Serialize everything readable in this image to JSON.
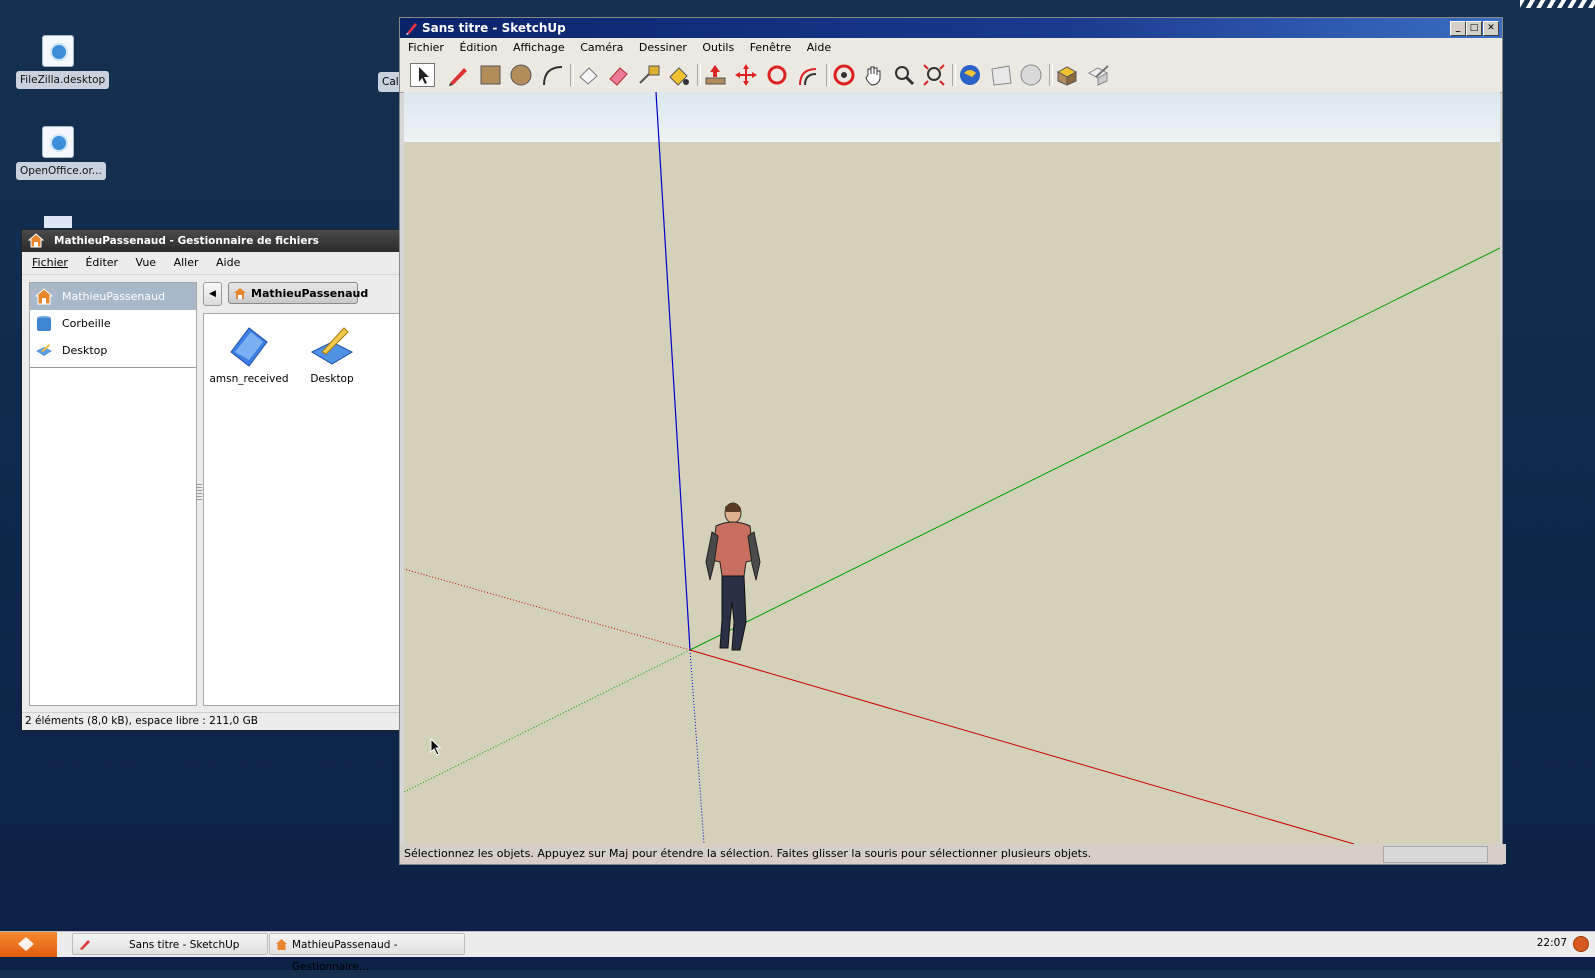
{
  "desktop": {
    "icons": [
      {
        "label": "FileZilla.desktop"
      },
      {
        "label": "OpenOffice.or..."
      }
    ],
    "partial_label": "Cal"
  },
  "file_manager": {
    "title": "MathieuPassenaud - Gestionnaire de fichiers",
    "menu": [
      "Fichier",
      "Éditer",
      "Vue",
      "Aller",
      "Aide"
    ],
    "sidebar": [
      {
        "label": "MathieuPassenaud",
        "icon": "home-icon",
        "selected": true
      },
      {
        "label": "Corbeille",
        "icon": "trash-icon",
        "selected": false
      },
      {
        "label": "Desktop",
        "icon": "desktop-icon",
        "selected": false
      }
    ],
    "breadcrumb": "MathieuPassenaud",
    "files": [
      {
        "label": "amsn_received",
        "icon": "folder-icon"
      },
      {
        "label": "Desktop",
        "icon": "desktop-folder-icon"
      }
    ],
    "status": "2 éléments (8,0 kB), espace libre : 211,0 GB"
  },
  "sketchup": {
    "title": "Sans titre - SketchUp",
    "menu": [
      "Fichier",
      "Édition",
      "Affichage",
      "Caméra",
      "Dessiner",
      "Outils",
      "Fenêtre",
      "Aide"
    ],
    "tools": [
      "select-icon",
      "pencil-icon",
      "rectangle-icon",
      "circle-icon",
      "arc-icon",
      "paint-bucket-icon",
      "eraser-icon",
      "tape-measure-icon",
      "paint-icon",
      "push-pull-icon",
      "move-icon",
      "rotate-icon",
      "offset-icon",
      "orbit-icon",
      "pan-icon",
      "zoom-icon",
      "zoom-extents-icon",
      "get-models-icon",
      "share-model-icon",
      "3d-warehouse-icon",
      "components-icon",
      "styles-icon"
    ],
    "status": "Sélectionnez les objets. Appuyez sur Maj pour étendre la sélection. Faites glisser la souris pour sélectionner plusieurs objets.",
    "colors": {
      "ground": "#d3d1b9",
      "red_axis": "#cc0000",
      "green_axis": "#00a000",
      "blue_axis": "#0000cc"
    }
  },
  "taskbar": {
    "tasks": [
      {
        "label": "Sans titre - SketchUp"
      },
      {
        "label": "MathieuPassenaud - Gestionnaire..."
      }
    ],
    "clock": "22:07"
  }
}
